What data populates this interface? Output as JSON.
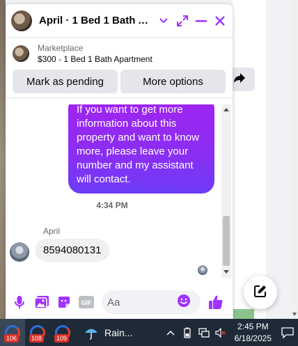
{
  "chat": {
    "title": "April · 1 Bed 1 Bath Ap...",
    "listing": {
      "source": "Marketplace",
      "name": "$300 - 1 Bed 1 Bath Apartment",
      "buttons": {
        "mark_pending": "Mark as pending",
        "more_options": "More options"
      }
    },
    "messages": {
      "outgoing_text": "If you want to get more information about this property and want to know more, please leave your number and my assistant will contact.",
      "time_separator": "4:34 PM",
      "sender_name": "April",
      "incoming_text": "8594080131"
    },
    "composer": {
      "placeholder": "Aa",
      "gif_label": "GIF"
    },
    "accent_color": "#a033ff",
    "icons": [
      "chevron-down-icon",
      "expand-icon",
      "minimize-icon",
      "close-icon",
      "microphone-icon",
      "photo-icon",
      "sticker-icon",
      "gif-icon",
      "emoji-icon",
      "like-icon",
      "compose-icon",
      "share-icon"
    ]
  },
  "taskbar": {
    "apps": [
      {
        "badge": "106"
      },
      {
        "badge": "108"
      },
      {
        "badge": "109"
      }
    ],
    "weather_label": "Rain...",
    "clock_time": "2:45 PM",
    "clock_date": "6/18/2025"
  }
}
